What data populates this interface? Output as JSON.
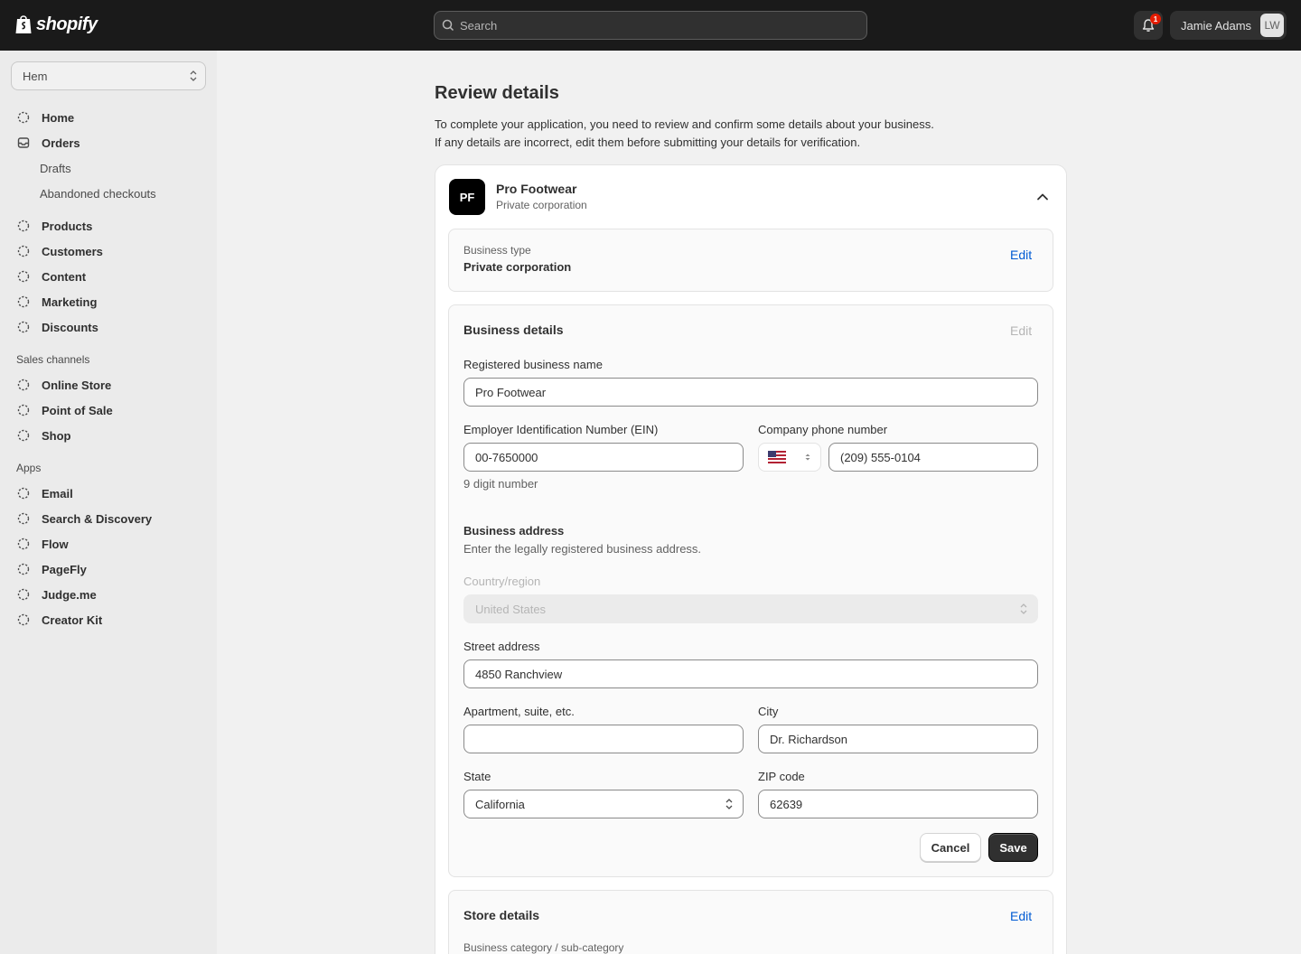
{
  "topbar": {
    "logo_text": "shopify",
    "search_placeholder": "Search",
    "notification_count": "1",
    "user_name": "Jamie Adams",
    "user_initials": "LW"
  },
  "sidebar": {
    "store_name": "Hem",
    "items": [
      {
        "label": "Home"
      },
      {
        "label": "Orders"
      },
      {
        "label": "Products"
      },
      {
        "label": "Customers"
      },
      {
        "label": "Content"
      },
      {
        "label": "Marketing"
      },
      {
        "label": "Discounts"
      }
    ],
    "order_subitems": [
      {
        "label": "Drafts"
      },
      {
        "label": "Abandoned checkouts"
      }
    ],
    "sales_channels_heading": "Sales channels",
    "sales_channels": [
      {
        "label": "Online Store"
      },
      {
        "label": "Point of Sale"
      },
      {
        "label": "Shop"
      }
    ],
    "apps_heading": "Apps",
    "apps": [
      {
        "label": "Email"
      },
      {
        "label": "Search & Discovery"
      },
      {
        "label": "Flow"
      },
      {
        "label": "PageFly"
      },
      {
        "label": "Judge.me"
      },
      {
        "label": "Creator Kit"
      }
    ]
  },
  "main": {
    "title": "Review details",
    "intro_line1": "To complete your application, you need to review and confirm some details about your business.",
    "intro_line2": "If any details are incorrect, edit them before submitting your details for verification.",
    "company": {
      "initials": "PF",
      "name": "Pro Footwear",
      "type": "Private corporation"
    },
    "business_type_card": {
      "label": "Business type",
      "value": "Private corporation",
      "edit": "Edit"
    },
    "business_details": {
      "title": "Business details",
      "edit": "Edit",
      "registered_name_label": "Registered business name",
      "registered_name_value": "Pro Footwear",
      "ein_label": "Employer Identification Number (EIN)",
      "ein_value": "00-7650000",
      "ein_help": "9 digit number",
      "phone_label": "Company phone number",
      "phone_value": "(209) 555-0104",
      "address_title": "Business address",
      "address_help": "Enter the legally registered business address.",
      "country_label": "Country/region",
      "country_value": "United States",
      "street_label": "Street address",
      "street_value": "4850 Ranchview",
      "apt_label": "Apartment, suite, etc.",
      "apt_value": "",
      "city_label": "City",
      "city_value": "Dr. Richardson",
      "state_label": "State",
      "state_value": "California",
      "zip_label": "ZIP code",
      "zip_value": "62639",
      "cancel": "Cancel",
      "save": "Save"
    },
    "store_details": {
      "title": "Store details",
      "edit": "Edit",
      "category_label": "Business category / sub-category"
    }
  },
  "colors": {
    "topbar_bg": "#1a1a1a",
    "link": "#005bd3",
    "primary_button": "#303030",
    "badge": "#e51c00"
  }
}
